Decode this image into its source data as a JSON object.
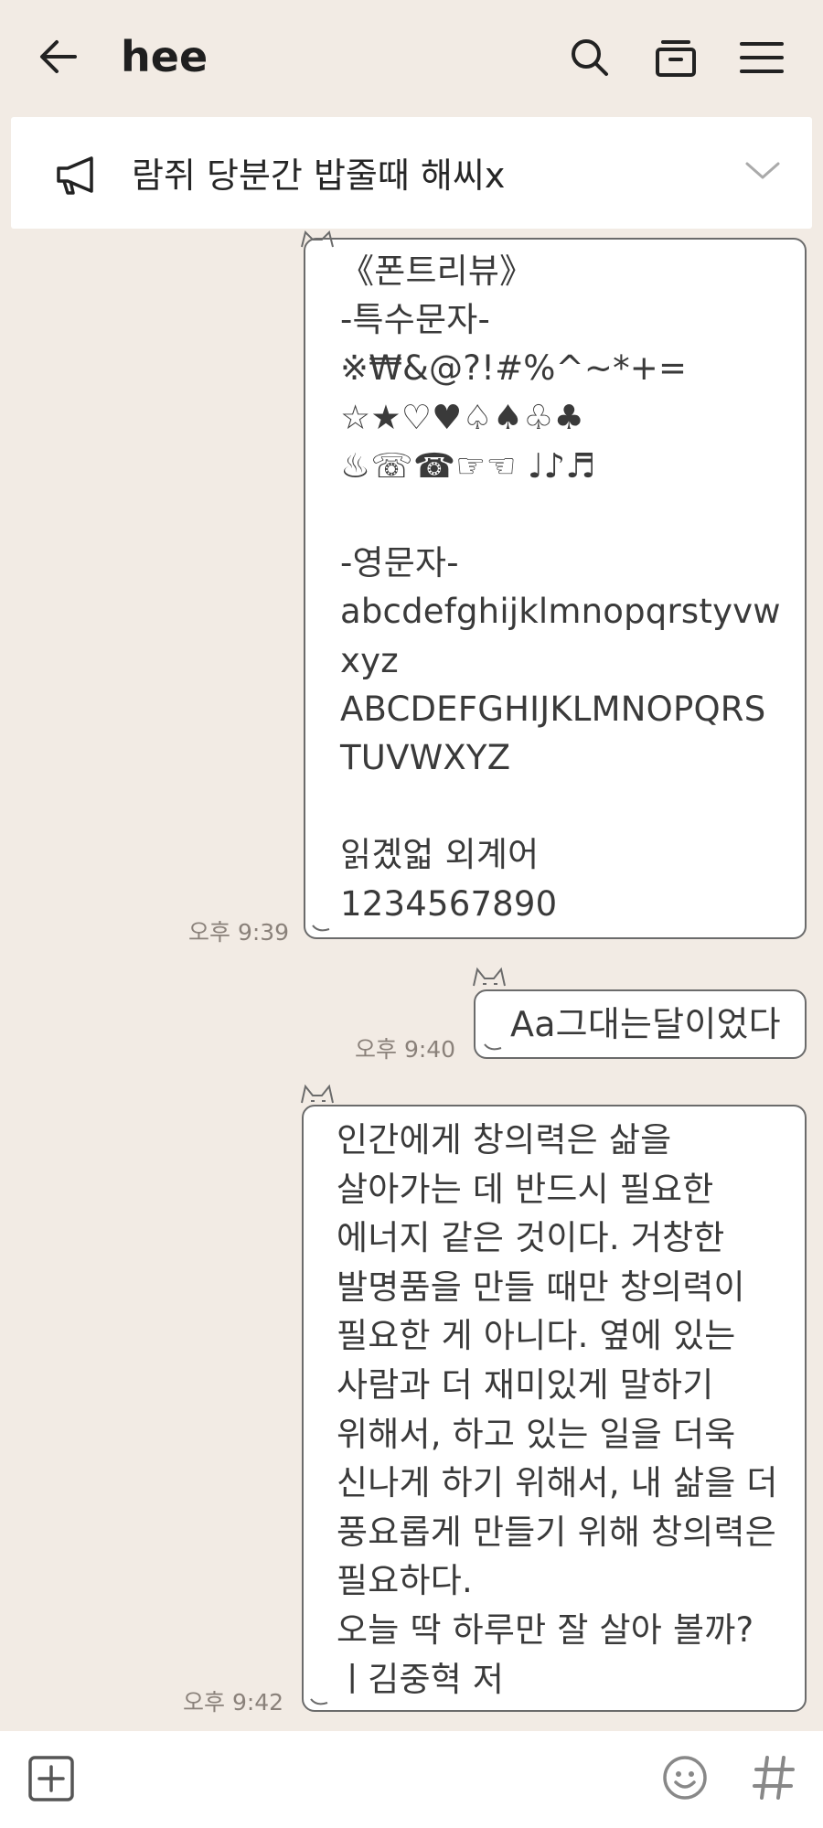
{
  "header": {
    "title": "hee",
    "icons": {
      "back": "back-arrow-icon",
      "search": "search-icon",
      "box": "drawer-icon",
      "menu": "menu-icon"
    }
  },
  "notice": {
    "icon": "megaphone-icon",
    "text": "람쥐 당분간 밥줄때 해씨x",
    "chevron": "chevron-down-icon"
  },
  "messages": [
    {
      "text": "《폰트리뷰》\n-특수문자-\n※₩&@?!#%^~*+=\n☆★♡♥♤♠♧♣\n♨☏☎☞☜ ♩♪♬\n\n-영문자-\nabcdefghijklmnopqrstyvw\nxyz\nABCDEFGHIJKLMNOPQRS\nTUVWXYZ\n\n읽곘얿 외계어\n1234567890",
      "time": "오후 9:39"
    },
    {
      "text": "Aa그대는달이었다",
      "time": "오후 9:40"
    },
    {
      "text": "인간에게 창의력은 삶을\n살아가는 데 반드시 필요한\n에너지 같은 것이다. 거창한\n발명품을 만들 때만 창의력이\n필요한 게 아니다. 옆에 있는\n사람과 더 재미있게 말하기\n위해서, 하고 있는 일을 더욱\n신나게 하기 위해서, 내 삶을 더\n풍요롭게 만들기 위해 창의력은\n필요하다.\n오늘 딱 하루만 잘 살아 볼까?\nㅣ김중혁 저",
      "time": "오후 9:42"
    }
  ],
  "bottom_bar": {
    "icons": {
      "plus": "plus-box-icon",
      "emoji": "emoji-icon",
      "hash": "hashtag-icon"
    }
  },
  "colors": {
    "background": "#f2ebe4",
    "bubble": "#ffffff",
    "bubble_border": "#6b6b6b",
    "time_text": "#8a817a"
  }
}
